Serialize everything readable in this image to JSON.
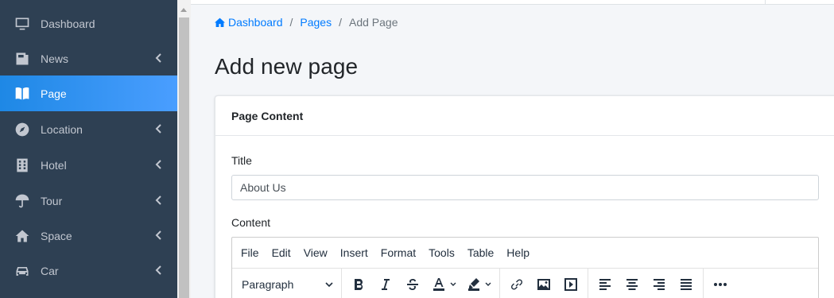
{
  "sidebar": {
    "items": [
      {
        "label": "Dashboard",
        "icon": "monitor-icon",
        "has_chevron": false
      },
      {
        "label": "News",
        "icon": "newspaper-icon",
        "has_chevron": true
      },
      {
        "label": "Page",
        "icon": "book-icon",
        "has_chevron": false,
        "active": true
      },
      {
        "label": "Location",
        "icon": "compass-icon",
        "has_chevron": true
      },
      {
        "label": "Hotel",
        "icon": "building-icon",
        "has_chevron": true
      },
      {
        "label": "Tour",
        "icon": "umbrella-icon",
        "has_chevron": true
      },
      {
        "label": "Space",
        "icon": "home-icon",
        "has_chevron": true
      },
      {
        "label": "Car",
        "icon": "car-icon",
        "has_chevron": true
      }
    ],
    "active_color": "#3399ff",
    "bg_color": "#2e4053"
  },
  "breadcrumb": {
    "home": "Dashboard",
    "pages": "Pages",
    "current": "Add Page",
    "separator": "/"
  },
  "page": {
    "title": "Add new page"
  },
  "card": {
    "header": "Page Content",
    "title_label": "Title",
    "title_value": "About Us",
    "content_label": "Content"
  },
  "editor": {
    "menu": [
      "File",
      "Edit",
      "View",
      "Insert",
      "Format",
      "Tools",
      "Table",
      "Help"
    ],
    "block_format": "Paragraph"
  }
}
